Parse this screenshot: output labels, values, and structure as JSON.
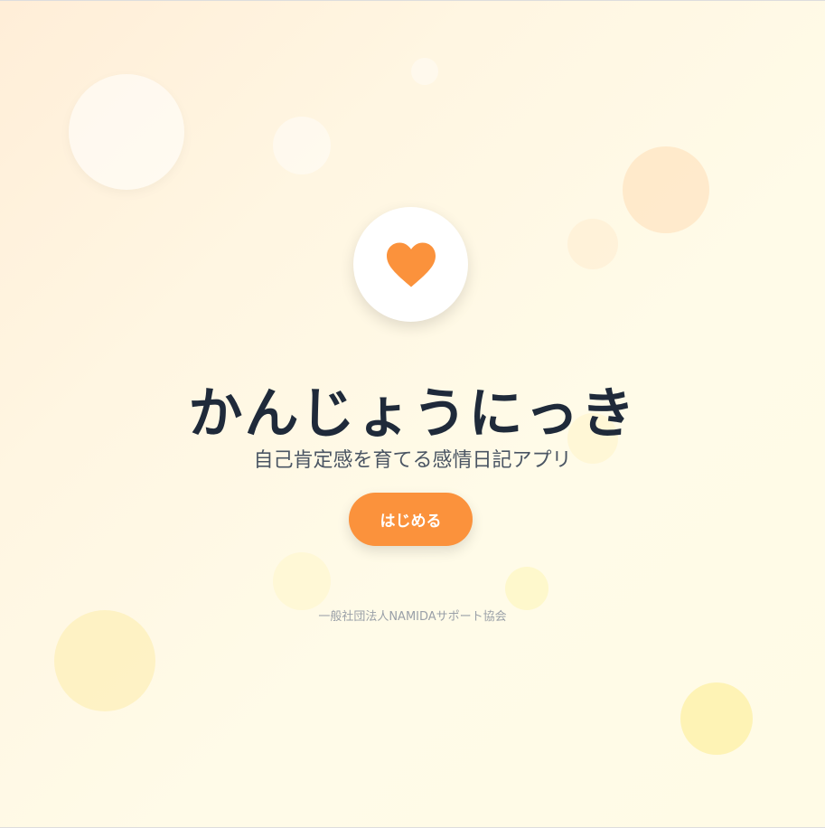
{
  "app": {
    "title": "かんじょうにっき",
    "subtitle": "自己肯定感を育てる感情日記アプリ",
    "start_button": "はじめる",
    "organization": "一般社団法人NAMIDAサポート協会",
    "logo_icon": "heart-icon"
  },
  "colors": {
    "accent": "#fb923c",
    "title": "#1f2a3a"
  }
}
